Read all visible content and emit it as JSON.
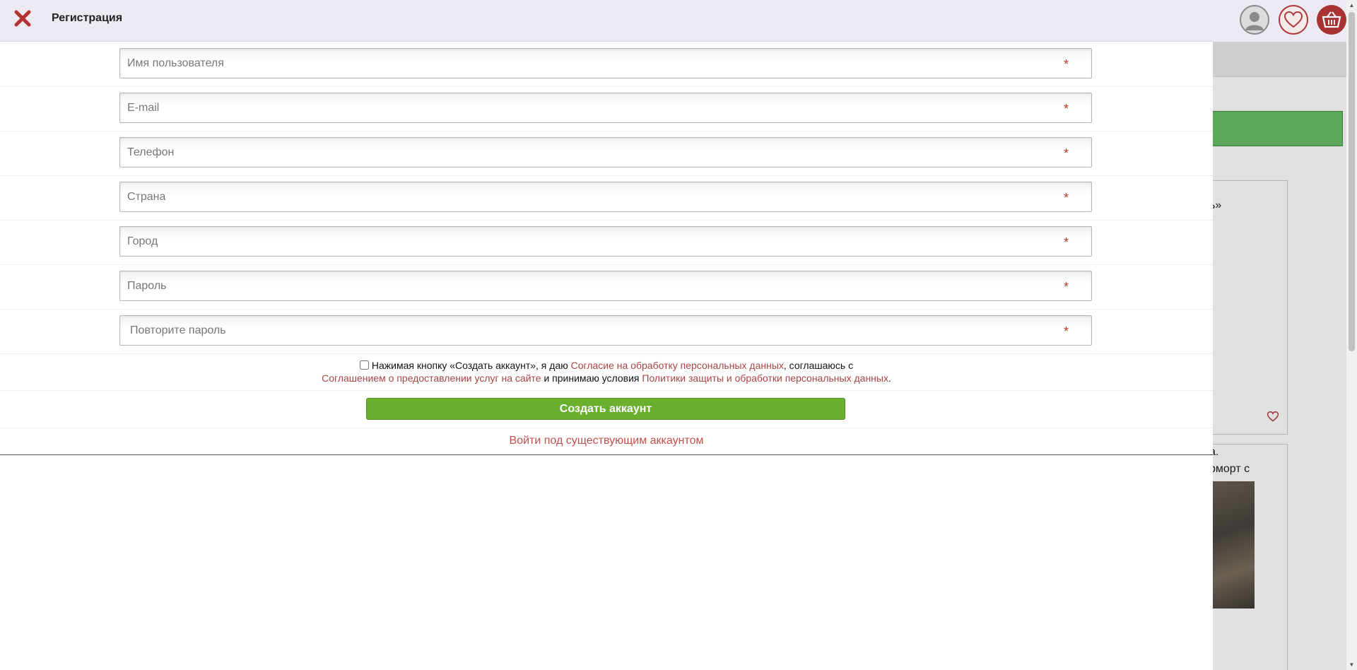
{
  "modal": {
    "title": "Регистрация",
    "fields": [
      {
        "placeholder": "Имя пользователя",
        "required_mark": "*"
      },
      {
        "placeholder": "E-mail",
        "required_mark": "*"
      },
      {
        "placeholder": "Телефон",
        "required_mark": "*"
      },
      {
        "placeholder": "Страна",
        "required_mark": "*"
      },
      {
        "placeholder": "Город",
        "required_mark": "*"
      },
      {
        "placeholder": "Пароль",
        "required_mark": "*"
      },
      {
        "placeholder": "Повторите пароль",
        "required_mark": "*"
      }
    ],
    "consent": {
      "text_1": "Нажимая кнопку «Создать аккаунт», я даю ",
      "link_1": "Согласие на обработку персональных данных",
      "text_2": ", соглашаюсь с",
      "link_2": "Соглашением о предоставлении услуг на сайте",
      "text_3": " и принимаю условия ",
      "link_3": "Политики защиты и обработки персональных данных",
      "text_4": "."
    },
    "submit_label": "Создать аккаунт",
    "login_link": "Войти под существующим аккаунтом"
  },
  "background": {
    "header_icons": [
      "user-icon",
      "heart-icon",
      "basket-icon"
    ],
    "card1_text": "ь»",
    "card2_text_1": "а.",
    "card2_text_2": "рморт с"
  },
  "colors": {
    "header_bg": "#edeaf4",
    "accent_red": "#a94442",
    "submit_green": "#6aaf2e"
  }
}
